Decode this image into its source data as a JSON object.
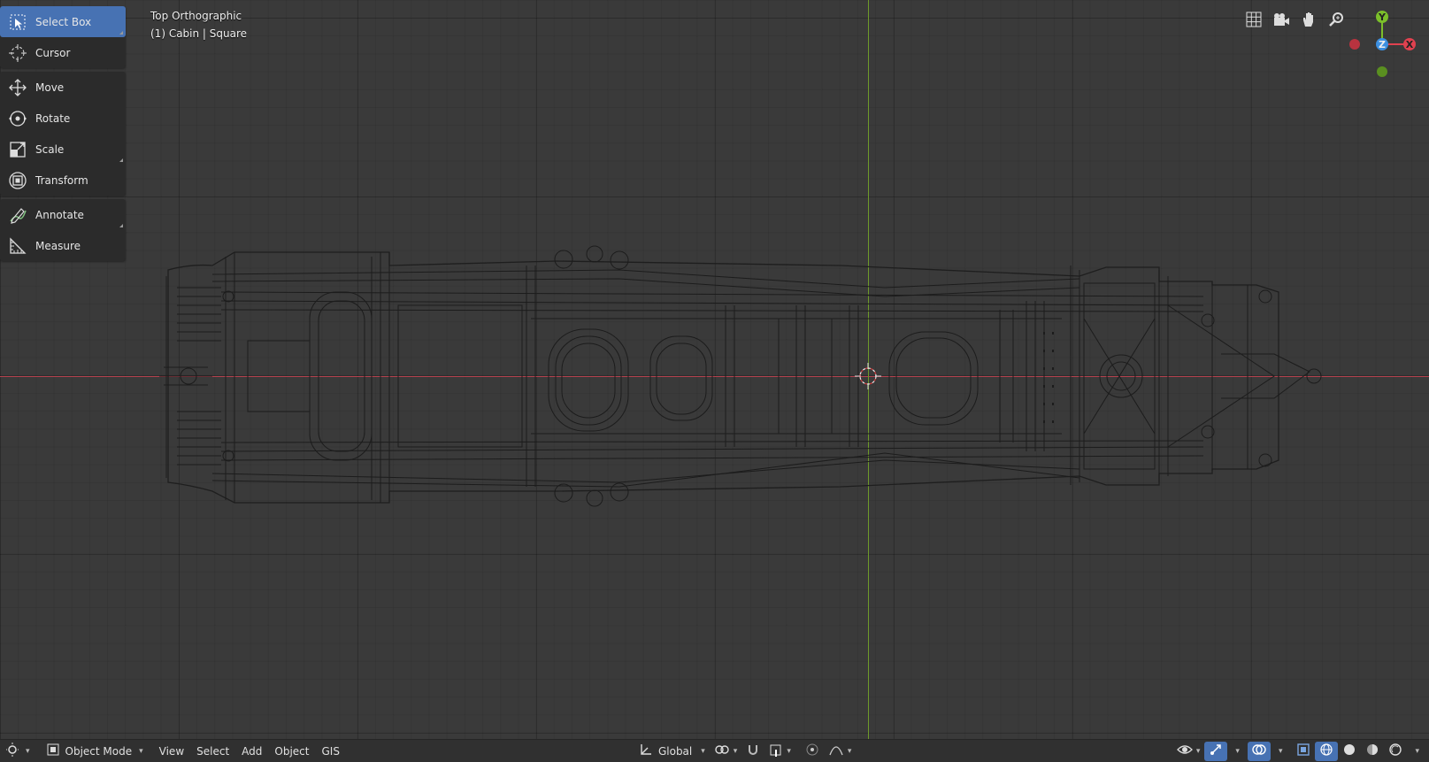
{
  "app": "Blender 3D Viewport",
  "viewport": {
    "view_name": "Top Orthographic",
    "object_info": "(1) Cabin | Square"
  },
  "toolbar": {
    "tools": [
      {
        "label": "Select Box",
        "icon": "select-box-icon",
        "active": true
      },
      {
        "label": "Cursor",
        "icon": "cursor-icon"
      },
      {
        "label": "Move",
        "icon": "move-icon"
      },
      {
        "label": "Rotate",
        "icon": "rotate-icon"
      },
      {
        "label": "Scale",
        "icon": "scale-icon"
      },
      {
        "label": "Transform",
        "icon": "transform-icon"
      },
      {
        "label": "Annotate",
        "icon": "annotate-icon"
      },
      {
        "label": "Measure",
        "icon": "measure-icon"
      }
    ]
  },
  "gizmo": {
    "y_label": "Y",
    "z_label": "Z",
    "x_label": "X",
    "colors": {
      "x": "#e0414f",
      "y": "#7bbf2a",
      "z": "#3c8fe0"
    }
  },
  "nav_buttons": [
    "grid-toggle-icon",
    "camera-view-icon",
    "pan-hand-icon",
    "zoom-icon"
  ],
  "header": {
    "editor_type_icon": "editor-type-icon",
    "mode": "Object Mode",
    "menus": [
      "View",
      "Select",
      "Add",
      "Object",
      "GIS"
    ],
    "orientation": "Global",
    "pivot_icon": "pivot-icon",
    "snap_icon": "snap-icon",
    "proportional_icon": "proportional-edit-icon",
    "right_icons": [
      "visibility-icon",
      "gizmo-toggle-icon",
      "overlay-toggle-icon",
      "xray-toggle-icon",
      "wireframe-shading-icon",
      "solid-shading-icon",
      "material-shading-icon",
      "rendered-shading-icon"
    ]
  },
  "colors": {
    "active_tool": "#4772b3",
    "axis_x": "#b5424e",
    "axis_y": "#6e9a2a",
    "background": "#3a3a3a"
  }
}
